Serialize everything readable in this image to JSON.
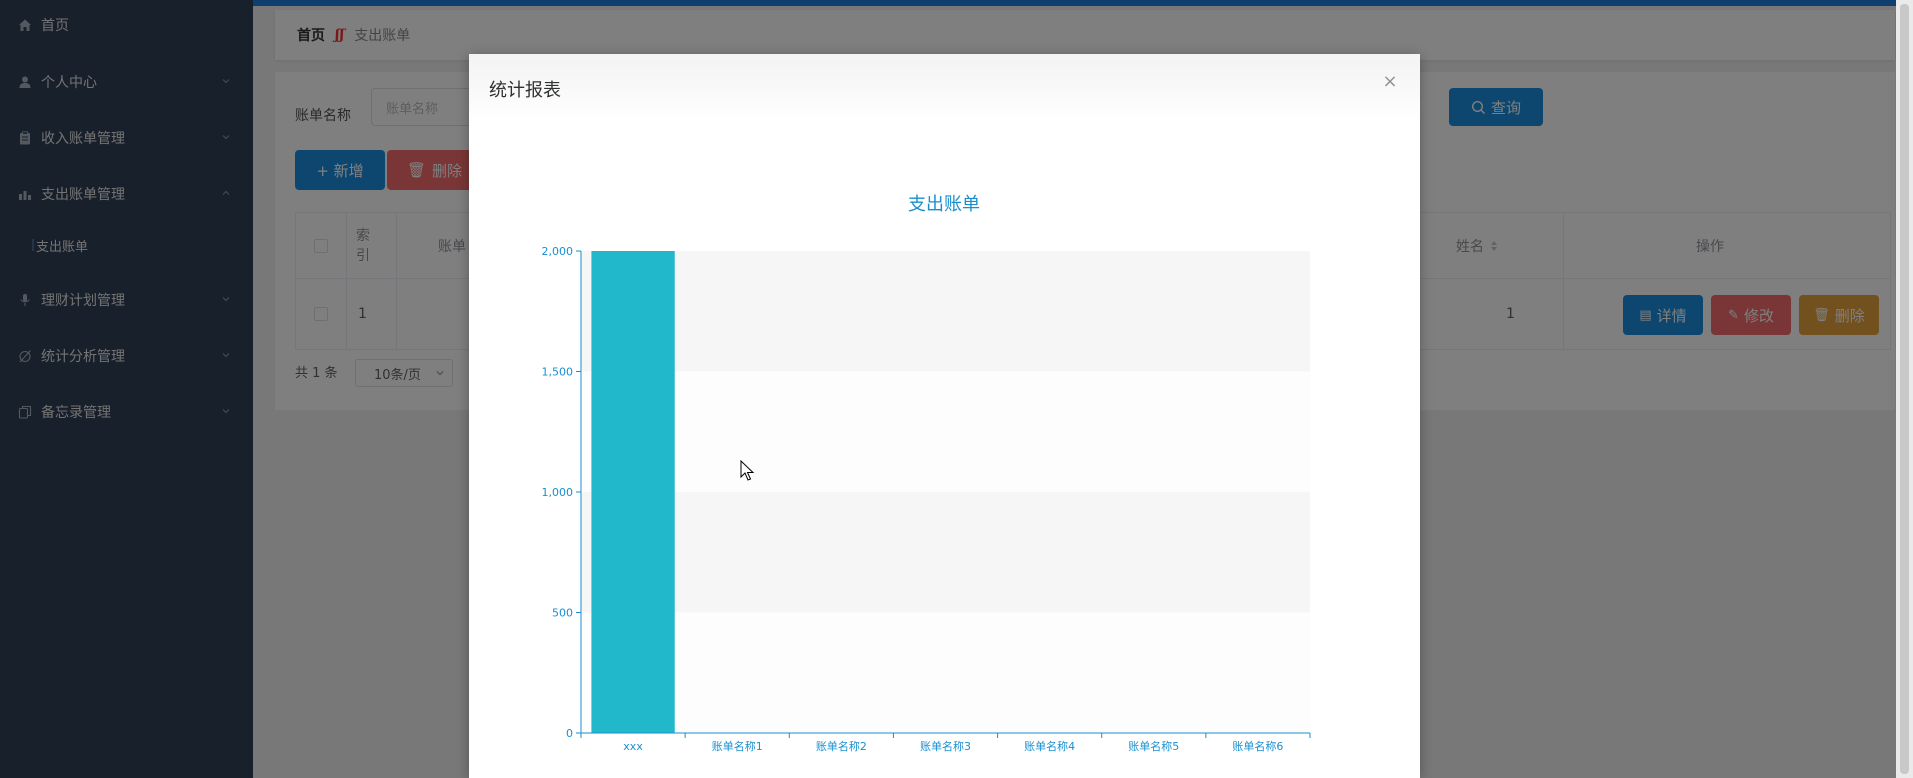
{
  "sidebar": {
    "items": [
      {
        "label": "首页",
        "icon": "home-icon",
        "has_arrow": false
      },
      {
        "label": "个人中心",
        "icon": "user-icon",
        "has_arrow": true
      },
      {
        "label": "收入账单管理",
        "icon": "clipboard-icon",
        "has_arrow": true
      },
      {
        "label": "支出账单管理",
        "icon": "chart-bar-icon",
        "has_arrow": true,
        "expanded": true
      },
      {
        "label": "理财计划管理",
        "icon": "microphone-icon",
        "has_arrow": true
      },
      {
        "label": "统计分析管理",
        "icon": "pie-slash-icon",
        "has_arrow": true
      },
      {
        "label": "备忘录管理",
        "icon": "copy-icon",
        "has_arrow": true
      }
    ],
    "subitem": "支出账单"
  },
  "breadcrumb": {
    "home": "首页",
    "separator": "ʃʃ",
    "current": "支出账单"
  },
  "search": {
    "label": "账单名称",
    "placeholder": "账单名称",
    "query_label": "查询"
  },
  "toolbar": {
    "add_label": "+ 新增",
    "delete_label": "删除"
  },
  "table": {
    "headers": {
      "index_line1": "索",
      "index_line2": "引",
      "bill": "账单",
      "name": "姓名",
      "operation": "操作"
    },
    "rows": [
      {
        "index": "1",
        "name": "1"
      }
    ],
    "actions": {
      "detail": "详情",
      "edit": "修改",
      "delete": "删除"
    }
  },
  "pager": {
    "total": "共 1 条",
    "page_size": "10条/页"
  },
  "dialog": {
    "title": "统计报表",
    "close": "×"
  },
  "colors": {
    "sidebar_bg": "#304156",
    "primary": "#1a8fe0",
    "danger": "#f56c6c",
    "warning": "#e6a23c",
    "bar": "#22b8cc",
    "axis": "#1a8fcf"
  },
  "chart_data": {
    "type": "bar",
    "title": "支出账单",
    "categories": [
      "xxx",
      "账单名称1",
      "账单名称2",
      "账单名称3",
      "账单名称4",
      "账单名称5",
      "账单名称6"
    ],
    "values": [
      2000,
      2,
      2,
      2,
      2,
      2,
      2
    ],
    "ylim": [
      0,
      2000
    ],
    "yticks": [
      0,
      500,
      1000,
      1500,
      2000
    ],
    "ytick_labels": [
      "0",
      "500",
      "1,000",
      "1,500",
      "2,000"
    ],
    "xlabel": "",
    "ylabel": "",
    "grid": "alternating-bands"
  }
}
